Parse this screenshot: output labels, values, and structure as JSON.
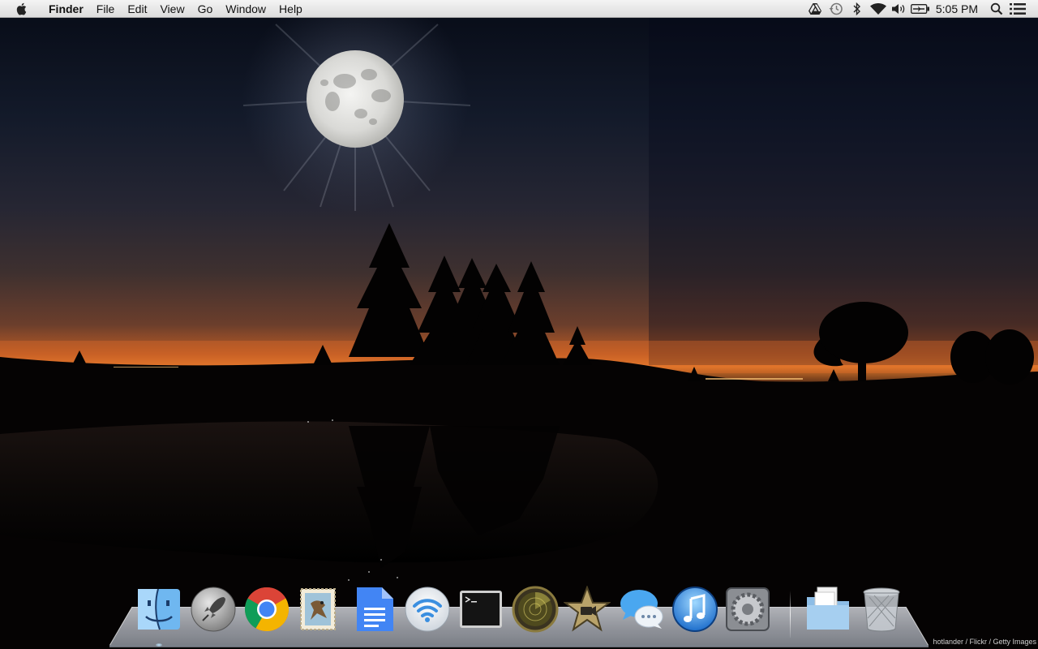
{
  "menubar": {
    "apple_icon": "apple-icon",
    "app_name": "Finder",
    "menus": [
      "File",
      "Edit",
      "View",
      "Go",
      "Window",
      "Help"
    ],
    "status_icons": [
      "google-drive-icon",
      "time-machine-icon",
      "bluetooth-icon",
      "wifi-icon",
      "volume-icon",
      "battery-icon"
    ],
    "clock": "5:05 PM",
    "spotlight_icon": "spotlight-search-icon",
    "notifications_icon": "notification-center-icon"
  },
  "wallpaper": {
    "credit": "hotlander / Flickr / Getty Images"
  },
  "dock": {
    "apps": [
      {
        "name": "finder",
        "running": true
      },
      {
        "name": "launchpad",
        "running": false
      },
      {
        "name": "chrome",
        "running": false
      },
      {
        "name": "mail",
        "running": false
      },
      {
        "name": "google-docs",
        "running": false
      },
      {
        "name": "wifi-diagnostics",
        "running": false
      },
      {
        "name": "terminal",
        "running": false
      },
      {
        "name": "radar",
        "running": false
      },
      {
        "name": "imovie",
        "running": false
      },
      {
        "name": "messages",
        "running": false
      },
      {
        "name": "itunes",
        "running": false
      },
      {
        "name": "system-preferences",
        "running": false
      }
    ],
    "stacks": [
      {
        "name": "documents-folder"
      },
      {
        "name": "trash"
      }
    ]
  },
  "colors": {
    "menubar": "#e6e6e6",
    "sky_top": "#0a1224",
    "horizon_glow": "#c05a2a"
  }
}
